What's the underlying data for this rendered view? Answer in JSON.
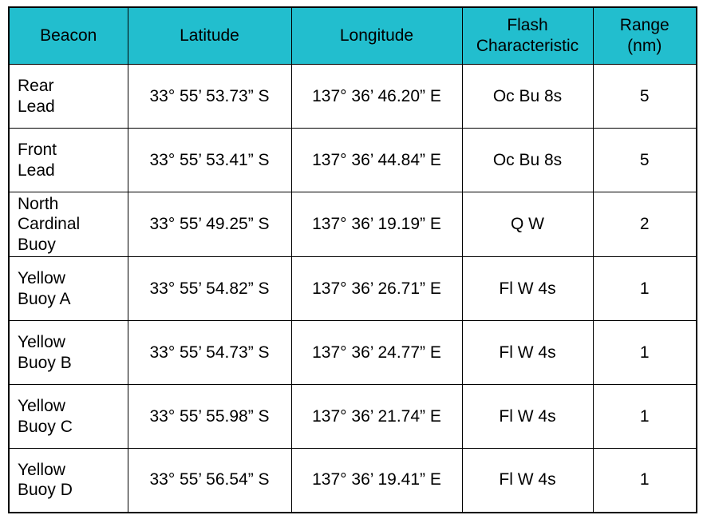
{
  "table": {
    "title": "Beacon",
    "accent_color": "#22BECE",
    "border_color": "#000000",
    "columns": [
      {
        "key": "beacon",
        "label": "Beacon",
        "label_line1": "Beacon",
        "label_line2": ""
      },
      {
        "key": "latitude",
        "label": "Latitude",
        "label_line1": "Latitude",
        "label_line2": ""
      },
      {
        "key": "longitude",
        "label": "Longitude",
        "label_line1": "Longitude",
        "label_line2": ""
      },
      {
        "key": "flash",
        "label": "Flash Characteristic",
        "label_line1": "Flash",
        "label_line2": "Characteristic"
      },
      {
        "key": "range",
        "label": "Range (nm)",
        "label_line1": "Range",
        "label_line2": "(nm)"
      }
    ],
    "rows": [
      {
        "beacon": "Rear Lead",
        "beacon_line1": "Rear",
        "beacon_line2": "Lead",
        "beacon_line3": "",
        "latitude": "33° 55’ 53.73” S",
        "longitude": "137° 36’ 46.20” E",
        "flash": "Oc Bu 8s",
        "range": "5"
      },
      {
        "beacon": "Front Lead",
        "beacon_line1": "Front",
        "beacon_line2": "Lead",
        "beacon_line3": "",
        "latitude": "33° 55’ 53.41” S",
        "longitude": "137° 36’ 44.84” E",
        "flash": "Oc Bu 8s",
        "range": "5"
      },
      {
        "beacon": "North Cardinal Buoy",
        "beacon_line1": "North",
        "beacon_line2": "Cardinal",
        "beacon_line3": "Buoy",
        "latitude": "33° 55’ 49.25” S",
        "longitude": "137° 36’ 19.19” E",
        "flash": "Q W",
        "range": "2"
      },
      {
        "beacon": "Yellow Buoy A",
        "beacon_line1": "Yellow",
        "beacon_line2": "Buoy A",
        "beacon_line3": "",
        "latitude": "33° 55’ 54.82” S",
        "longitude": "137° 36’ 26.71” E",
        "flash": "Fl W 4s",
        "range": "1"
      },
      {
        "beacon": "Yellow Buoy B",
        "beacon_line1": "Yellow",
        "beacon_line2": "Buoy B",
        "beacon_line3": "",
        "latitude": "33° 55’ 54.73” S",
        "longitude": "137° 36’ 24.77” E",
        "flash": "Fl W 4s",
        "range": "1"
      },
      {
        "beacon": "Yellow Buoy C",
        "beacon_line1": "Yellow",
        "beacon_line2": "Buoy C",
        "beacon_line3": "",
        "latitude": "33° 55’ 55.98” S",
        "longitude": "137° 36’ 21.74” E",
        "flash": "Fl W 4s",
        "range": "1"
      },
      {
        "beacon": "Yellow Buoy D",
        "beacon_line1": "Yellow",
        "beacon_line2": "Buoy D",
        "beacon_line3": "",
        "latitude": "33° 55’ 56.54” S",
        "longitude": "137° 36’ 19.41” E",
        "flash": "Fl W 4s",
        "range": "1"
      }
    ]
  },
  "chart_data": {
    "type": "table",
    "title": "Beacon",
    "columns": [
      "Beacon",
      "Latitude",
      "Longitude",
      "Flash Characteristic",
      "Range (nm)"
    ],
    "rows": [
      [
        "Rear Lead",
        "33° 55’ 53.73” S",
        "137° 36’ 46.20” E",
        "Oc Bu 8s",
        "5"
      ],
      [
        "Front Lead",
        "33° 55’ 53.41” S",
        "137° 36’ 44.84” E",
        "Oc Bu 8s",
        "5"
      ],
      [
        "North Cardinal Buoy",
        "33° 55’ 49.25” S",
        "137° 36’ 19.19” E",
        "Q W",
        "2"
      ],
      [
        "Yellow Buoy A",
        "33° 55’ 54.82” S",
        "137° 36’ 26.71” E",
        "Fl W 4s",
        "1"
      ],
      [
        "Yellow Buoy B",
        "33° 55’ 54.73” S",
        "137° 36’ 24.77” E",
        "Fl W 4s",
        "1"
      ],
      [
        "Yellow Buoy C",
        "33° 55’ 55.98” S",
        "137° 36’ 21.74” E",
        "Fl W 4s",
        "1"
      ],
      [
        "Yellow Buoy D",
        "33° 55’ 56.54” S",
        "137° 36’ 19.41” E",
        "Fl W 4s",
        "1"
      ]
    ]
  }
}
